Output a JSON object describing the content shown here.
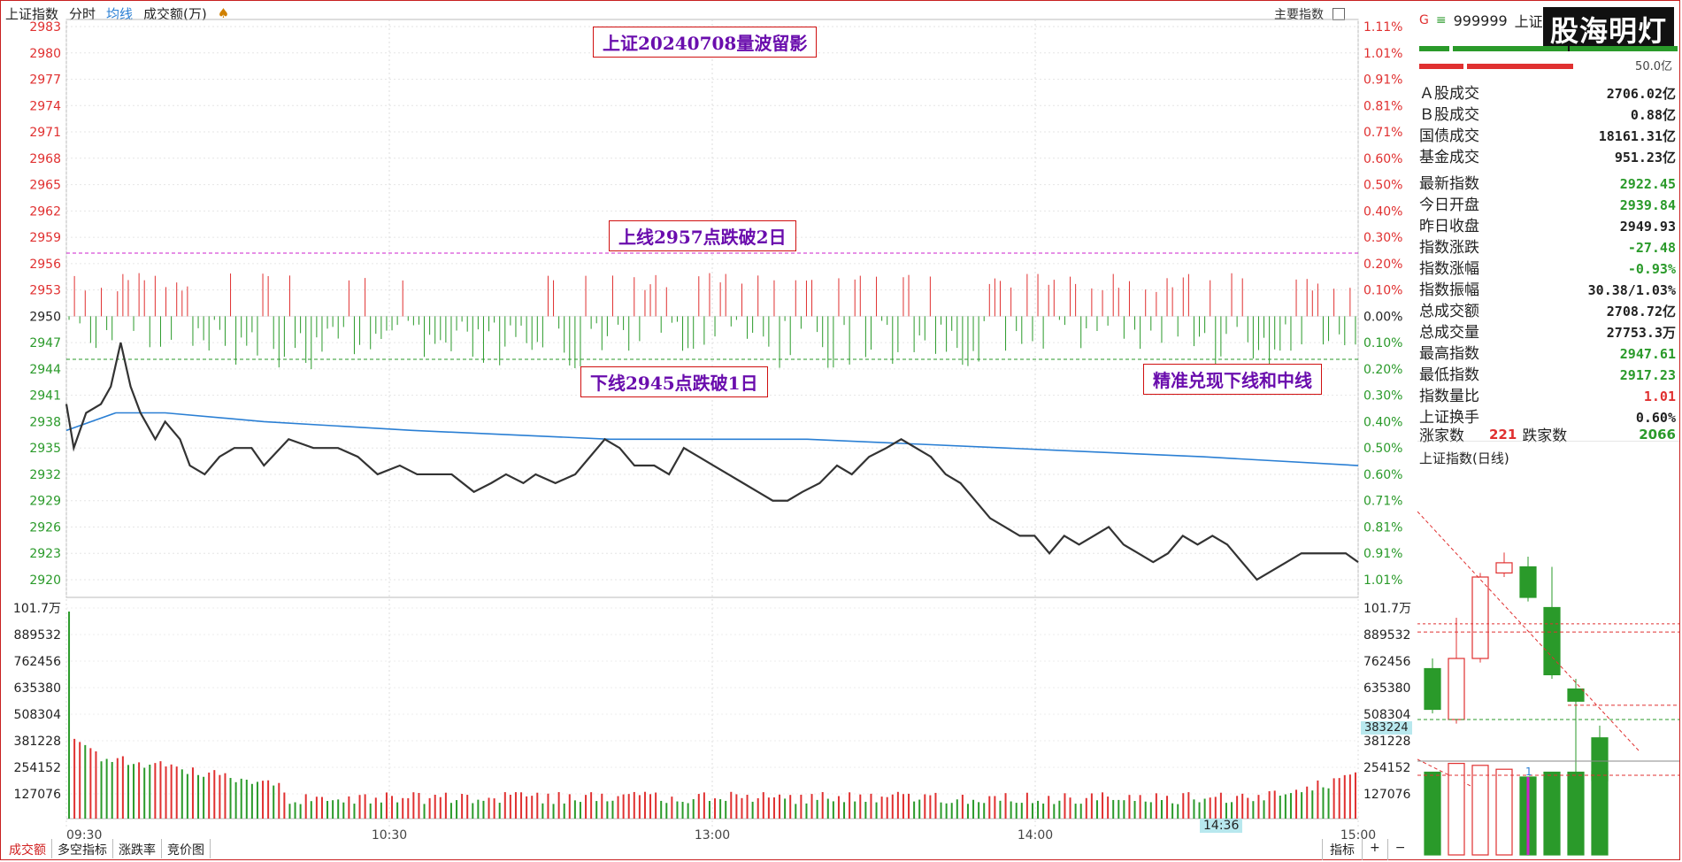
{
  "chart_header": {
    "index_name": "上证指数",
    "tab_timeshare": "分时",
    "tab_avg": "均线",
    "tab_volume": "成交额(万)",
    "main_index": "主要指数"
  },
  "annotations": {
    "title": "上证20240708量波留影",
    "upper": "上线2957点跌破2日",
    "lower": "下线2945点跌破1日",
    "note": "精准兑现下线和中线"
  },
  "price_axis_left": [
    "2983",
    "2980",
    "2977",
    "2974",
    "2971",
    "2968",
    "2965",
    "2962",
    "2959",
    "2956",
    "2953",
    "2950",
    "2947",
    "2944",
    "2941",
    "2938",
    "2935",
    "2932",
    "2929",
    "2926",
    "2923",
    "2920"
  ],
  "pct_axis_right": [
    "1.11%",
    "1.01%",
    "0.91%",
    "0.81%",
    "0.71%",
    "0.60%",
    "0.50%",
    "0.40%",
    "0.30%",
    "0.20%",
    "0.10%",
    "0.00%",
    "0.10%",
    "0.20%",
    "0.30%",
    "0.40%",
    "0.50%",
    "0.60%",
    "0.71%",
    "0.81%",
    "0.91%",
    "1.01%"
  ],
  "volume_axis": [
    "101.7万",
    "889532",
    "762456",
    "635380",
    "508304",
    "381228",
    "254152",
    "127076"
  ],
  "time_axis": [
    "09:30",
    "10:30",
    "13:00",
    "14:00",
    "15:00"
  ],
  "cursor_time": "14:36",
  "cursor_volume": "383224",
  "bottom_tabs": [
    "成交额",
    "多空指标",
    "涨跌率",
    "竞价图"
  ],
  "bottom_right": [
    "指标",
    "+",
    "−"
  ],
  "right_panel": {
    "code_prefix": "G",
    "code": "999999",
    "name_short": "上证",
    "logo": "股海明灯",
    "turnover_cap": "50.0亿",
    "stats": [
      {
        "label": "Ａ股成交",
        "value": "2706.02亿",
        "color": "#222"
      },
      {
        "label": "Ｂ股成交",
        "value": "0.88亿",
        "color": "#222"
      },
      {
        "label": "国债成交",
        "value": "18161.31亿",
        "color": "#222"
      },
      {
        "label": "基金成交",
        "value": "951.23亿",
        "color": "#222"
      },
      {
        "label": "最新指数",
        "value": "2922.45",
        "color": "#2a9a2a"
      },
      {
        "label": "今日开盘",
        "value": "2939.84",
        "color": "#2a9a2a"
      },
      {
        "label": "昨日收盘",
        "value": "2949.93",
        "color": "#222"
      },
      {
        "label": "指数涨跌",
        "value": "-27.48",
        "color": "#2a9a2a"
      },
      {
        "label": "指数涨幅",
        "value": "-0.93%",
        "color": "#2a9a2a"
      },
      {
        "label": "指数振幅",
        "value": "30.38/1.03%",
        "color": "#222"
      },
      {
        "label": "总成交额",
        "value": "2708.72亿",
        "color": "#222"
      },
      {
        "label": "总成交量",
        "value": "27753.3万",
        "color": "#222"
      },
      {
        "label": "最高指数",
        "value": "2947.61",
        "color": "#2a9a2a"
      },
      {
        "label": "最低指数",
        "value": "2917.23",
        "color": "#2a9a2a"
      },
      {
        "label": "指数量比",
        "value": "1.01",
        "color": "#e03030"
      },
      {
        "label": "上证换手",
        "value": "0.60%",
        "color": "#222"
      }
    ],
    "rise_label": "涨家数",
    "rise_count": "221",
    "fall_label": "跌家数",
    "fall_count": "2066",
    "daily_title": "上证指数(日线)",
    "daily_marker": "1"
  },
  "colors": {
    "up": "#e03030",
    "down": "#2a9a2a",
    "avg": "#2a7fd4",
    "price": "#333333",
    "annot_text": "#6a0dad",
    "magenta_line": "#cc22cc"
  },
  "chart_data": {
    "type": "line",
    "title": "上证20240708量波留影",
    "prev_close": 2949.93,
    "ylim": [
      2920,
      2983
    ],
    "x": [
      "09:30",
      "10:30",
      "13:00",
      "14:00",
      "15:00"
    ],
    "series": [
      {
        "name": "price",
        "points": [
          [
            0,
            2940
          ],
          [
            3,
            2935
          ],
          [
            8,
            2939
          ],
          [
            14,
            2940
          ],
          [
            18,
            2942
          ],
          [
            22,
            2947
          ],
          [
            26,
            2942
          ],
          [
            30,
            2939
          ],
          [
            36,
            2936
          ],
          [
            40,
            2938
          ],
          [
            46,
            2936
          ],
          [
            50,
            2933
          ],
          [
            56,
            2932
          ],
          [
            62,
            2934
          ],
          [
            68,
            2935
          ],
          [
            75,
            2935
          ],
          [
            80,
            2933
          ],
          [
            90,
            2936
          ],
          [
            100,
            2935
          ],
          [
            110,
            2935
          ],
          [
            118,
            2934
          ],
          [
            126,
            2932
          ],
          [
            135,
            2933
          ],
          [
            142,
            2932
          ],
          [
            150,
            2932
          ],
          [
            156,
            2932
          ],
          [
            165,
            2930
          ],
          [
            172,
            2931
          ],
          [
            178,
            2932
          ],
          [
            185,
            2931
          ],
          [
            190,
            2932
          ],
          [
            198,
            2931
          ],
          [
            206,
            2932
          ],
          [
            212,
            2934
          ],
          [
            218,
            2936
          ],
          [
            224,
            2935
          ],
          [
            230,
            2933
          ],
          [
            238,
            2933
          ],
          [
            244,
            2932
          ],
          [
            250,
            2935
          ],
          [
            256,
            2934
          ],
          [
            262,
            2933
          ],
          [
            268,
            2932
          ],
          [
            274,
            2931
          ],
          [
            280,
            2930
          ],
          [
            286,
            2929
          ],
          [
            292,
            2929
          ],
          [
            298,
            2930
          ],
          [
            305,
            2931
          ],
          [
            312,
            2933
          ],
          [
            318,
            2932
          ],
          [
            325,
            2934
          ],
          [
            332,
            2935
          ],
          [
            338,
            2936
          ],
          [
            344,
            2935
          ],
          [
            350,
            2934
          ],
          [
            356,
            2932
          ],
          [
            362,
            2931
          ],
          [
            368,
            2929
          ],
          [
            374,
            2927
          ],
          [
            380,
            2926
          ],
          [
            386,
            2925
          ],
          [
            392,
            2925
          ],
          [
            398,
            2923
          ],
          [
            404,
            2925
          ],
          [
            410,
            2924
          ],
          [
            416,
            2925
          ],
          [
            422,
            2926
          ],
          [
            428,
            2924
          ],
          [
            434,
            2923
          ],
          [
            440,
            2922
          ],
          [
            446,
            2923
          ],
          [
            452,
            2925
          ],
          [
            458,
            2924
          ],
          [
            464,
            2925
          ],
          [
            470,
            2924
          ],
          [
            476,
            2922
          ],
          [
            482,
            2920
          ],
          [
            488,
            2921
          ],
          [
            494,
            2922
          ],
          [
            500,
            2923
          ],
          [
            506,
            2923
          ],
          [
            512,
            2923
          ],
          [
            518,
            2923
          ],
          [
            523,
            2922
          ]
        ]
      },
      {
        "name": "avg",
        "points": [
          [
            0,
            2937
          ],
          [
            20,
            2939
          ],
          [
            40,
            2939
          ],
          [
            80,
            2938
          ],
          [
            140,
            2937
          ],
          [
            220,
            2936
          ],
          [
            300,
            2936
          ],
          [
            380,
            2935
          ],
          [
            460,
            2934
          ],
          [
            523,
            2933
          ]
        ]
      }
    ],
    "reference_lines": [
      {
        "value": 2957,
        "label": "上线2957点跌破2日"
      },
      {
        "value": 2945,
        "label": "下线2945点跌破1日"
      }
    ],
    "volume_ylim": [
      0,
      1017000
    ]
  }
}
